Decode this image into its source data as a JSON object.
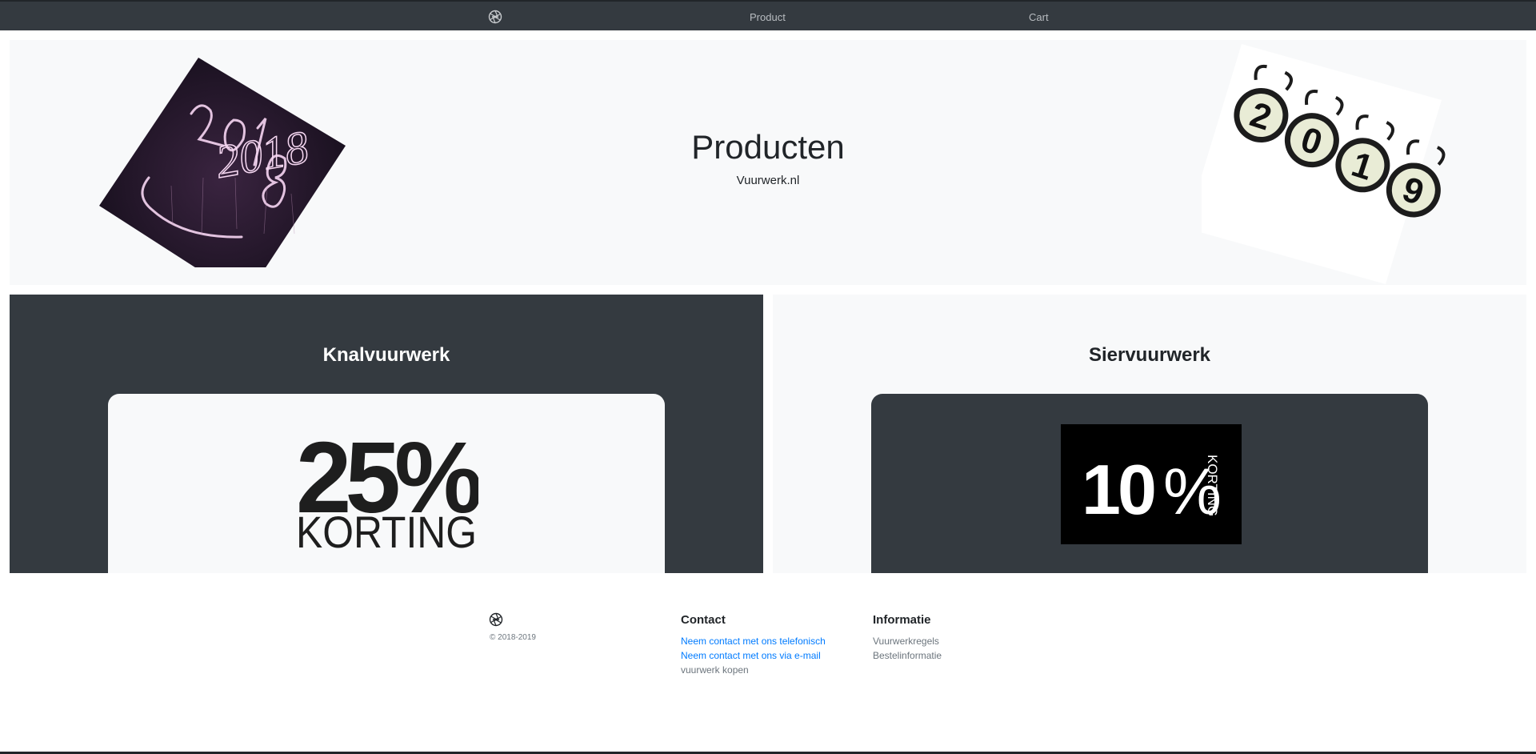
{
  "navbar": {
    "logo_icon": "camera-aperture-icon",
    "product_label": "Product",
    "cart_label": "Cart"
  },
  "hero": {
    "title": "Producten",
    "subtitle": "Vuurwerk.nl",
    "left_image_text": "2018",
    "right_image_digits": [
      "2",
      "0",
      "1",
      "9"
    ]
  },
  "panels": [
    {
      "title": "Knalvuurwerk",
      "promo_number": "25%",
      "promo_word": "KORTING"
    },
    {
      "title": "Siervuurwerk",
      "promo_number": "10",
      "promo_percent": "%",
      "promo_word": "KORTING"
    }
  ],
  "footer": {
    "logo_icon": "camera-aperture-icon",
    "copyright": "© 2018-2019",
    "contact": {
      "heading": "Contact",
      "links": [
        "Neem contact met ons telefonisch",
        "Neem contact met ons via e-mail",
        "vuurwerk kopen"
      ]
    },
    "info": {
      "heading": "Informatie",
      "links": [
        "Vuurwerkregels",
        "Bestelinformatie"
      ]
    }
  },
  "colors": {
    "navbar_bg": "#343a40",
    "light_bg": "#f8f9fa",
    "dark_panel": "#343a40",
    "link_blue": "#007bff",
    "muted": "#6c757d"
  }
}
